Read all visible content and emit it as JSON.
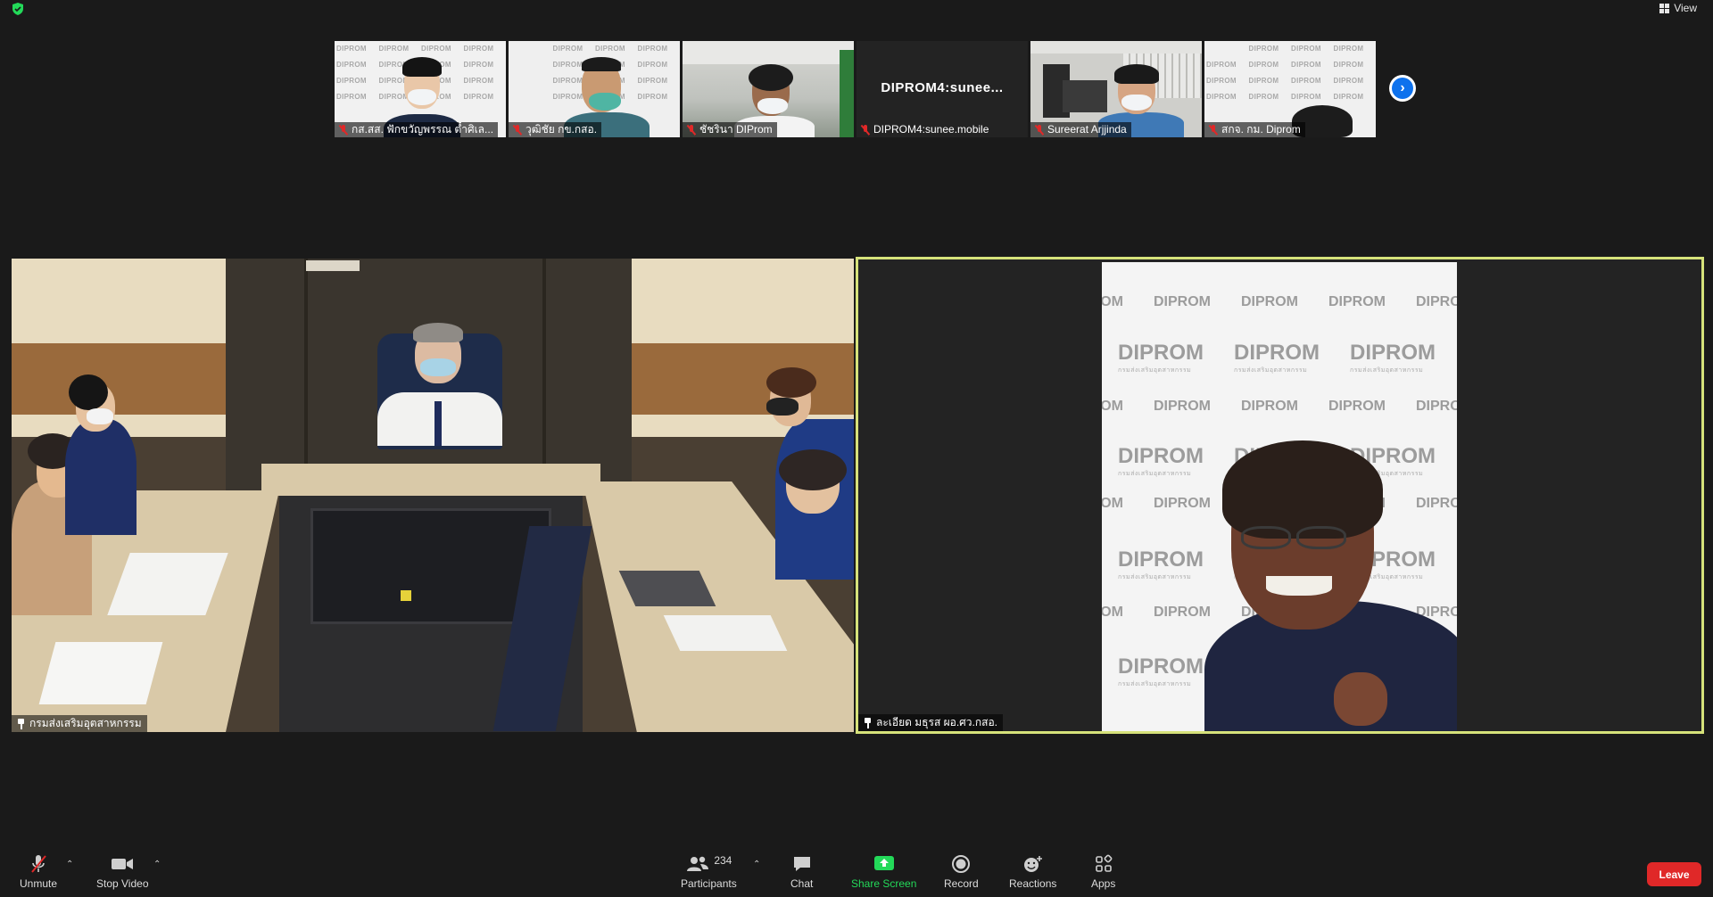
{
  "top_bar": {
    "view_label": "View"
  },
  "thumbnails": [
    {
      "name": "กส.สส. ฟักขวัญพรรณ ต๋ำศิเล...",
      "muted": true
    },
    {
      "name": "วุฒิชัย กข.กสอ.",
      "muted": true
    },
    {
      "name": "ชัชรินา DIProm",
      "muted": true
    },
    {
      "title": "DIPROM4:sunee...",
      "name": "DIPROM4:sunee.mobile",
      "muted": true
    },
    {
      "name": "Sureerat Arjjinda",
      "muted": true
    },
    {
      "name": "สกจ. กม. Diprom",
      "muted": true
    }
  ],
  "main_videos": {
    "left": {
      "name": "กรมส่งเสริมอุตสาหกรรม"
    },
    "right": {
      "name": "ละเอียด มธุรส ผอ.ศว.กสอ."
    }
  },
  "backdrop_word": "DIPROM",
  "toolbar": {
    "unmute": "Unmute",
    "stop_video": "Stop Video",
    "participants": "Participants",
    "participant_count": "234",
    "chat": "Chat",
    "share_screen": "Share Screen",
    "record": "Record",
    "reactions": "Reactions",
    "apps": "Apps",
    "leave": "Leave"
  },
  "colors": {
    "active_speaker_border": "#d6e27a",
    "share_green": "#23d959",
    "leave_red": "#e02828",
    "accent_blue": "#0e72ed"
  }
}
